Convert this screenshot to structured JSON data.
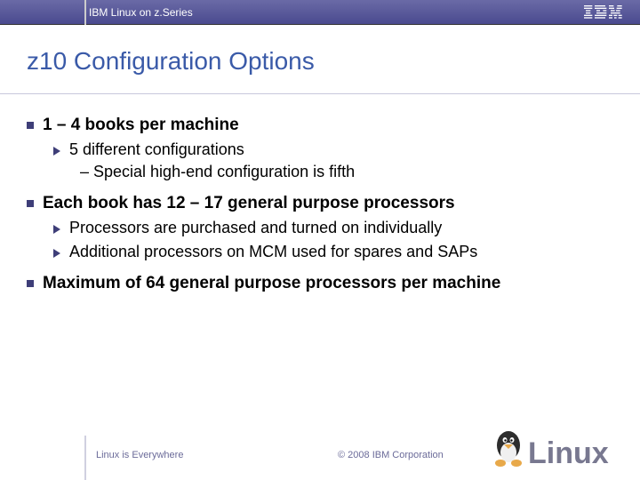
{
  "header": {
    "title": "IBM Linux on z.Series",
    "logo": "IBM"
  },
  "slide_title": "z10 Configuration Options",
  "bullets": [
    {
      "text": "1 – 4 books per machine",
      "children": [
        {
          "text": "5 different configurations",
          "children": [
            {
              "text": "– Special high-end configuration is fifth"
            }
          ]
        }
      ]
    },
    {
      "text": "Each book has 12 – 17 general purpose processors",
      "children": [
        {
          "text": "Processors are purchased and turned on individually"
        },
        {
          "text": "Additional processors on MCM used for spares and SAPs"
        }
      ]
    },
    {
      "text": "Maximum of 64 general purpose processors per machine"
    }
  ],
  "footer": {
    "left": "Linux is Everywhere",
    "copyright": "© 2008 IBM Corporation",
    "brand": "Linux"
  }
}
